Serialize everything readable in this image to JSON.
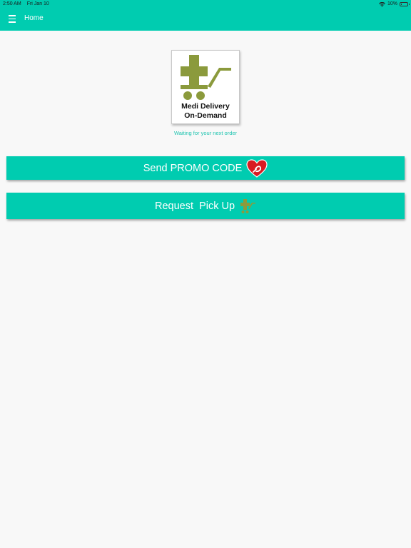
{
  "status_bar": {
    "time": "2:50 AM",
    "date": "Fri Jan 10",
    "battery": "10%",
    "icons": [
      "wifi-icon",
      "battery-icon"
    ]
  },
  "header": {
    "title": "Home",
    "menu_icon": "hamburger-menu-icon"
  },
  "logo": {
    "line1": "Medi Delivery",
    "line2": "On-Demand",
    "icon": "medical-cart-icon",
    "color": "#8b9a3c"
  },
  "status_message": "Waiting for your next order",
  "buttons": {
    "promo_label": "Send PROMO CODE",
    "promo_icon": "heart-icon",
    "pickup_label": "Request  Pick Up",
    "pickup_icon": "pickup-cart-icon"
  },
  "colors": {
    "accent": "#00ccb0",
    "heart": "#d81b22",
    "background": "#f8f8f8"
  }
}
